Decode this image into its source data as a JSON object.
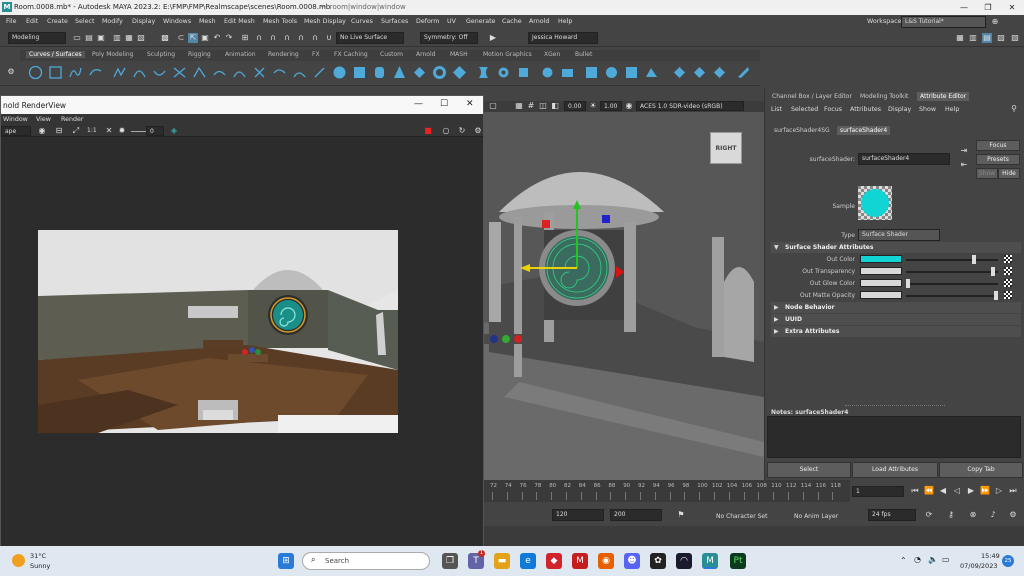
{
  "window": {
    "title": "Room.0008.mb* - Autodesk MAYA 2023.2: E:\\FMP\\FMP\\Realmscape\\scenes\\Room.0008.mb",
    "title_suffix": "--- room|window|window"
  },
  "menus": [
    "File",
    "Edit",
    "Create",
    "Select",
    "Modify",
    "Display",
    "Windows",
    "Mesh",
    "Edit Mesh",
    "Mesh Tools",
    "Mesh Display",
    "Curves",
    "Surfaces",
    "Deform",
    "UV",
    "Generate",
    "Cache",
    "Arnold",
    "Help"
  ],
  "workspace": {
    "label": "Workspace:",
    "value": "L&S Tutorial*"
  },
  "statusline": {
    "mode": "Modeling",
    "live_surface": "No Live Surface",
    "symmetry": "Symmetry: Off",
    "user": "Jessica Howard"
  },
  "shelf_tabs": [
    "Curves / Surfaces",
    "Poly Modeling",
    "Sculpting",
    "Rigging",
    "Animation",
    "Rendering",
    "FX",
    "FX Caching",
    "Custom",
    "Arnold",
    "MASH",
    "Motion Graphics",
    "XGen",
    "Bullet"
  ],
  "shelf_active_tab": "Curves / Surfaces",
  "renderview": {
    "title": "nold RenderView",
    "menus": [
      "Window",
      "View",
      "Render"
    ],
    "camera_dropdown": "ape",
    "ratio_label": "1:1",
    "exposure_value": "0"
  },
  "viewport": {
    "field1": "0.00",
    "field2": "1.00",
    "colorspace": "ACES 1.0 SDR-video (sRGB)",
    "viewcube_label": "RIGHT"
  },
  "attribute_editor": {
    "top_tabs": [
      "Channel Box / Layer Editor",
      "Modeling Toolkit",
      "Attribute Editor"
    ],
    "active_top_tab": "Attribute Editor",
    "menus": [
      "List",
      "Selected",
      "Focus",
      "Attributes",
      "Display",
      "Show",
      "Help"
    ],
    "node_tabs": [
      "surfaceShader4SG",
      "surfaceShader4"
    ],
    "active_node_tab": "surfaceShader4",
    "shader_label": "surfaceShader:",
    "shader_name": "surfaceShader4",
    "focus_btn": "Focus",
    "presets_btn": "Presets",
    "show_btn": "Show",
    "hide_btn": "Hide",
    "sample_label": "Sample",
    "type_label": "Type",
    "type_value": "Surface Shader",
    "sections": {
      "surface_shader_attrs": "Surface Shader Attributes",
      "node_behavior": "Node Behavior",
      "uuid": "UUID",
      "extra_attributes": "Extra Attributes"
    },
    "attributes": [
      {
        "label": "Out Color",
        "color": "#11d4d4",
        "level": 0.75
      },
      {
        "label": "Out Transparency",
        "color": "#d8d8d8",
        "level": 0.97
      },
      {
        "label": "Out Glow Color",
        "color": "#d8d8d8",
        "level": 0.0
      },
      {
        "label": "Out Matte Opacity",
        "color": "#d8d8d8",
        "level": 1.0
      }
    ],
    "notes_label": "Notes: surfaceShader4",
    "bottom_buttons": [
      "Select",
      "Load Attributes",
      "Copy Tab"
    ]
  },
  "timeline": {
    "ticks": [
      "72",
      "74",
      "76",
      "78",
      "80",
      "82",
      "84",
      "86",
      "88",
      "90",
      "92",
      "94",
      "96",
      "98",
      "100",
      "102",
      "104",
      "106",
      "108",
      "110",
      "112",
      "114",
      "116",
      "118"
    ],
    "current_frame": "1",
    "range_start": "120",
    "range_end": "200",
    "character_set": "No Character Set",
    "anim_layer": "No Anim Layer",
    "fps": "24 fps"
  },
  "taskbar": {
    "weather_temp": "31°C",
    "weather_text": "Sunny",
    "search_placeholder": "Search",
    "time": "15:49",
    "date": "07/09/2023",
    "badge": "1",
    "notif_count": "25"
  },
  "colors": {
    "maya_teal": "#2a8f95",
    "shader_cyan": "#11d4d4",
    "panel_bg": "#444444",
    "selection_blue": "#5285a6"
  }
}
